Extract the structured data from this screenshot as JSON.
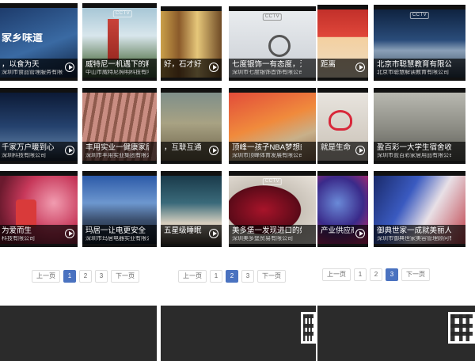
{
  "panels": [
    {
      "items": [
        {
          "title": "家乡味道",
          "subtitle": "",
          "logo": ""
        },
        {
          "title": "威特尼一机遇下的精工",
          "subtitle": "中山市威特尼照明科技有限公司",
          "logo": "CCTV"
        },
        {
          "title": "，以食为天",
          "subtitle": "深圳市食品管理服务有限公司",
          "logo": ""
        },
        {
          "title": "千家万户暖到心",
          "subtitle": "深圳科技有限公司",
          "logo": ""
        },
        {
          "title": "丰用实业一健康家居首选",
          "subtitle": "深圳市丰用实业集团有限公司",
          "logo": ""
        },
        {
          "title": "为爱而生",
          "subtitle": "科技有限公司",
          "logo": ""
        },
        {
          "title": "玛居一让电更安全",
          "subtitle": "深圳市玛居电器实业有限公司",
          "logo": ""
        }
      ],
      "pager": {
        "prev": "上一页",
        "pages": [
          "1",
          "2",
          "3"
        ],
        "active": "1",
        "next": "下一页"
      }
    },
    {
      "items": [
        {
          "title": "好，石才好",
          "subtitle": "",
          "logo": ""
        },
        {
          "title": "七度银饰一有态度，无限度",
          "subtitle": "深圳市七度银饰首饰有限公司",
          "logo": "CCTV"
        },
        {
          "title": "，互联互通",
          "subtitle": "",
          "logo": ""
        },
        {
          "title": "顶峰一孩子NBA梦想的摇篮",
          "subtitle": "深圳市顶峰体育发展有限公司",
          "logo": "CCTV"
        },
        {
          "title": "五星级睡眠",
          "subtitle": "",
          "logo": ""
        },
        {
          "title": "美多堡一发现进口的好酒",
          "subtitle": "深圳美多堡贸易有限公司",
          "logo": "CCTV"
        }
      ],
      "pager": {
        "prev": "上一页",
        "pages": [
          "1",
          "2",
          "3"
        ],
        "active": "2",
        "next": "下一页"
      }
    },
    {
      "items": [
        {
          "title": "距离",
          "subtitle": "",
          "logo": ""
        },
        {
          "title": "北京市聪慧教育有限公司",
          "subtitle": "北京市聪慧解读教育有限公司",
          "logo": "CCTV"
        },
        {
          "title": "就是生命",
          "subtitle": "",
          "logo": ""
        },
        {
          "title": "盈百彩一大学生宿舍收纳品牌",
          "subtitle": "深圳市盈百彩家居用品有限公司",
          "logo": ""
        },
        {
          "title": "产业供应商",
          "subtitle": "",
          "logo": ""
        },
        {
          "title": "御典世家一成就美丽人生",
          "subtitle": "深圳市御典世家美容管理顾问有限公司",
          "logo": ""
        }
      ],
      "pager": {
        "prev": "上一页",
        "pages": [
          "1",
          "2",
          "3"
        ],
        "active": "3",
        "next": "下一页"
      }
    }
  ],
  "colors": {
    "active_page": "#4a72c0",
    "footer": "#2b2b2b",
    "caption_bg": "rgba(0,0,0,0.68)"
  }
}
